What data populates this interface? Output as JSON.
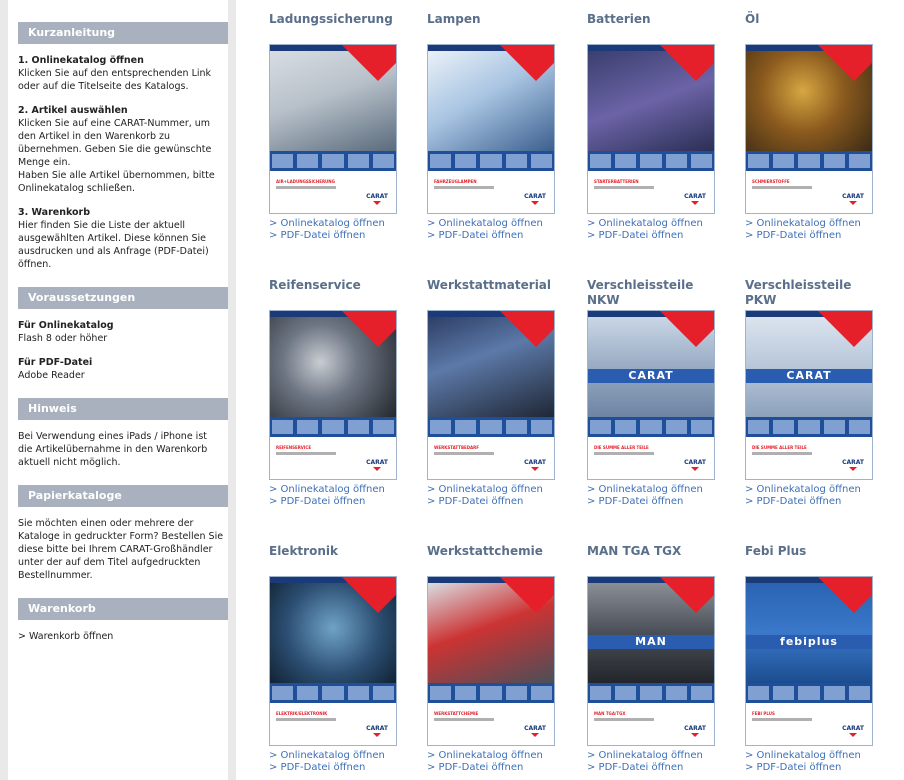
{
  "sidebar": {
    "quick": {
      "heading": "Kurzanleitung",
      "s1_title": "1. Onlinekatalog öffnen",
      "s1_text": "Klicken Sie auf den entsprechenden Link oder auf die Titelseite des Katalogs.",
      "s2_title": "2. Artikel auswählen",
      "s2_text": "Klicken Sie auf eine CARAT-Nummer, um den Artikel in den Warenkorb zu übernehmen. Geben Sie die gewünschte Menge ein.",
      "s2_text2": "Haben Sie alle Artikel übernommen, bitte Onlinekatalog schließen.",
      "s3_title": "3. Warenkorb",
      "s3_text": "Hier finden Sie die Liste der aktuell ausgewählten Artikel. Diese können Sie ausdrucken und als Anfrage (PDF-Datei) öffnen."
    },
    "requirements": {
      "heading": "Voraussetzungen",
      "r1_title": "Für Onlinekatalog",
      "r1_text": "Flash 8 oder höher",
      "r2_title": "Für PDF-Datei",
      "r2_text": "Adobe Reader"
    },
    "hint": {
      "heading": "Hinweis",
      "text": "Bei Verwendung eines iPads / iPhone ist die Artikelübernahme in den Warenkorb aktuell nicht möglich."
    },
    "paper": {
      "heading": "Papierkataloge",
      "text": "Sie möchten einen oder mehrere der Kataloge in gedruckter Form? Bestellen Sie diese bitte bei Ihrem CARAT-Großhändler unter der auf dem Titel aufgedruckten Bestellnummer."
    },
    "cart": {
      "heading": "Warenkorb",
      "link": "> Warenkorb öffnen"
    }
  },
  "links": {
    "online": "> Onlinekatalog öffnen",
    "pdf": "> PDF-Datei öffnen"
  },
  "catalogs": [
    {
      "title": "Ladungssicherung",
      "cover_label": "AIR+LADUNGSSICHERUNG",
      "logo": "CARAT"
    },
    {
      "title": "Lampen",
      "cover_label": "FAHRZEUGLAMPEN",
      "logo": "CARAT"
    },
    {
      "title": "Batterien",
      "cover_label": "STARTERBATTERIEN",
      "logo": "CARAT"
    },
    {
      "title": "Öl",
      "cover_label": "SCHMIERSTOFFE",
      "logo": "CARAT"
    },
    {
      "title": "Reifenservice",
      "cover_label": "REIFENSERVICE",
      "logo": "CARAT"
    },
    {
      "title": "Werkstattmaterial",
      "cover_label": "WERKSTATTBEDARF",
      "logo": "CARAT"
    },
    {
      "title": "Verschleissteile NKW",
      "cover_label": "DIE SUMME ALLER TEILE",
      "logo": "CARAT",
      "banner": "CARAT"
    },
    {
      "title": "Verschleissteile PKW",
      "cover_label": "DIE SUMME ALLER TEILE",
      "logo": "CARAT",
      "banner": "CARAT"
    },
    {
      "title": "Elektronik",
      "cover_label": "ELEKTRIK/ELEKTRONIK",
      "logo": "CARAT"
    },
    {
      "title": "Werkstattchemie",
      "cover_label": "WERKSTATTCHEMIE",
      "logo": "CARAT"
    },
    {
      "title": "MAN TGA TGX",
      "cover_label": "MAN TGA/TGX",
      "logo": "CARAT",
      "banner": "MAN"
    },
    {
      "title": "Febi Plus",
      "cover_label": "FEBI PLUS",
      "logo": "CARAT",
      "banner": "febiplus"
    }
  ]
}
